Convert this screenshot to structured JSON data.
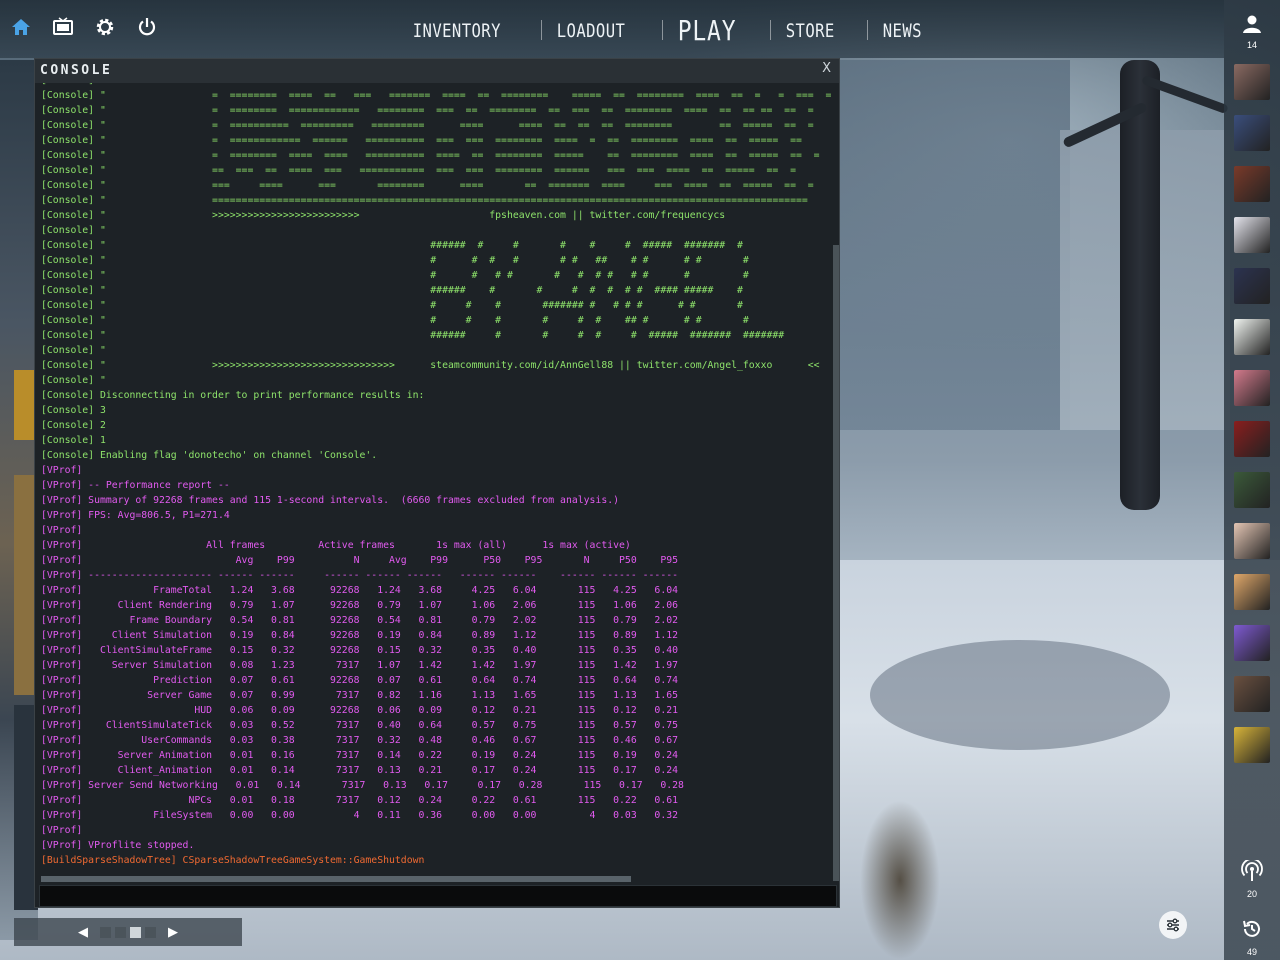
{
  "nav": {
    "items": [
      {
        "label": "INVENTORY",
        "name": "nav-inventory",
        "cls": ""
      },
      {
        "label": "LOADOUT",
        "name": "nav-loadout",
        "cls": ""
      },
      {
        "label": "PLAY",
        "name": "nav-play",
        "cls": "play"
      },
      {
        "label": "STORE",
        "name": "nav-store",
        "cls": ""
      },
      {
        "label": "NEWS",
        "name": "nav-news",
        "cls": ""
      }
    ],
    "icons": [
      "home-icon",
      "tv-icon",
      "gear-icon",
      "power-icon"
    ]
  },
  "sidebar": {
    "friends_count": "14",
    "avatars": [
      {
        "bg": "#8a6a62"
      },
      {
        "bg": "#3a4e7c"
      },
      {
        "bg": "#7a3a2a"
      },
      {
        "bg": "#e4e4ec"
      },
      {
        "bg": "#2c3350"
      },
      {
        "bg": "#f0f4f0"
      },
      {
        "bg": "#d37a8c"
      },
      {
        "bg": "#8a1e1e"
      },
      {
        "bg": "#3b5a3a"
      },
      {
        "bg": "#e4c6b4"
      },
      {
        "bg": "#e0a86a"
      },
      {
        "bg": "#7e5ad2"
      },
      {
        "bg": "#6a5040"
      },
      {
        "bg": "#d8b43a"
      }
    ],
    "broadcast_count": "20",
    "history_count": "49"
  },
  "console": {
    "title": "CONSOLE",
    "close_label": "X",
    "lines": [
      {
        "c": "con",
        "t": "[Console] \""
      },
      {
        "c": "con",
        "t": "[Console] \"                  =  ========  ====  ==   ===   =======  ====  ==  ========    =====  ==  ========  ====  ==  =   =  ===  ="
      },
      {
        "c": "con",
        "t": "[Console] \"                  =  ========  ============   ========  ===  ==  ========  ==  ===  ==  ========  ====  ==  == ==  ==  ="
      },
      {
        "c": "con",
        "t": "[Console] \"                  =  ==========  =========   =========      ====      ====  ==  ==  ==  ========        ==  =====  ==  ="
      },
      {
        "c": "con",
        "t": "[Console] \"                  =  ============  ======   ==========  ===  ===  ========  ====  =  ==  ========  ====  ==  =====  =="
      },
      {
        "c": "con",
        "t": "[Console] \"                  =  ========  ====  ====   ==========  ====  ==  ========  =====    ==  ========  ====  ==  =====  ==  ="
      },
      {
        "c": "con",
        "t": "[Console] \"                  ==  ===  ==  ====  ===   ===========  ===  ===  ========  ======   ===  ===  ====  ==  =====  ==  ="
      },
      {
        "c": "con",
        "t": "[Console] \"                  ===     ====      ===       ========      ====       ==  =======  ====     ===  ====  ==  =====  ==  ="
      },
      {
        "c": "con",
        "t": "[Console] \"                  ====================================================================================================="
      },
      {
        "c": "con",
        "t": "[Console] \"                  >>>>>>>>>>>>>>>>>>>>>>>>>                      fpsheaven.com || twitter.com/frequencycs"
      },
      {
        "c": "con",
        "t": "[Console] \""
      },
      {
        "c": "con",
        "t": "[Console] \"                                                       ######  #     #       #    #     #  #####  #######  #"
      },
      {
        "c": "con",
        "t": "[Console] \"                                                       #      #  #   #       # #   ##    # #      # #       #"
      },
      {
        "c": "con",
        "t": "[Console] \"                                                       #      #   # #       #   #  # #   # #      #         #"
      },
      {
        "c": "con",
        "t": "[Console] \"                                                       ######    #       #     #  #  #  # #  #### #####    #"
      },
      {
        "c": "con",
        "t": "[Console] \"                                                       #     #    #       ####### #   # # #      # #       #"
      },
      {
        "c": "con",
        "t": "[Console] \"                                                       #     #    #       #     #  #    ## #      # #       #"
      },
      {
        "c": "con",
        "t": "[Console] \"                                                       ######     #       #     #  #     #  #####  #######  #######"
      },
      {
        "c": "con",
        "t": "[Console] \""
      },
      {
        "c": "con",
        "t": "[Console] \"                  >>>>>>>>>>>>>>>>>>>>>>>>>>>>>>>      steamcommunity.com/id/AnnGell88 || twitter.com/Angel_foxxo      <<"
      },
      {
        "c": "con",
        "t": "[Console] \""
      },
      {
        "c": "con",
        "t": "[Console] Disconnecting in order to print performance results in:"
      },
      {
        "c": "con",
        "t": "[Console] 3"
      },
      {
        "c": "con",
        "t": "[Console] 2"
      },
      {
        "c": "con",
        "t": "[Console] 1"
      },
      {
        "c": "con",
        "t": "[Console] Enabling flag 'donotecho' on channel 'Console'."
      },
      {
        "c": "vp",
        "t": "[VProf]"
      },
      {
        "c": "vp",
        "t": "[VProf] -- Performance report --"
      },
      {
        "c": "vp",
        "t": "[VProf] Summary of 92268 frames and 115 1-second intervals.  (6660 frames excluded from analysis.)"
      },
      {
        "c": "vp",
        "t": "[VProf] FPS: Avg=806.5, P1=271.4"
      },
      {
        "c": "vp",
        "t": "[VProf]"
      },
      {
        "c": "vp",
        "t": "[VProf]                     All frames         Active frames       1s max (all)      1s max (active)"
      },
      {
        "c": "vp",
        "t": "[VProf]                          Avg    P99          N     Avg    P99      P50    P95       N     P50    P95"
      },
      {
        "c": "vp",
        "t": "[VProf] --------------------- ------ ------     ------ ------ ------   ------ ------    ------ ------ ------"
      },
      {
        "c": "vp",
        "t": "[VProf]            FrameTotal   1.24   3.68      92268   1.24   3.68     4.25   6.04       115   4.25   6.04"
      },
      {
        "c": "vp",
        "t": "[VProf]      Client Rendering   0.79   1.07      92268   0.79   1.07     1.06   2.06       115   1.06   2.06"
      },
      {
        "c": "vp",
        "t": "[VProf]        Frame Boundary   0.54   0.81      92268   0.54   0.81     0.79   2.02       115   0.79   2.02"
      },
      {
        "c": "vp",
        "t": "[VProf]     Client Simulation   0.19   0.84      92268   0.19   0.84     0.89   1.12       115   0.89   1.12"
      },
      {
        "c": "vp",
        "t": "[VProf]   ClientSimulateFrame   0.15   0.32      92268   0.15   0.32     0.35   0.40       115   0.35   0.40"
      },
      {
        "c": "vp",
        "t": "[VProf]     Server Simulation   0.08   1.23       7317   1.07   1.42     1.42   1.97       115   1.42   1.97"
      },
      {
        "c": "vp",
        "t": "[VProf]            Prediction   0.07   0.61      92268   0.07   0.61     0.64   0.74       115   0.64   0.74"
      },
      {
        "c": "vp",
        "t": "[VProf]           Server Game   0.07   0.99       7317   0.82   1.16     1.13   1.65       115   1.13   1.65"
      },
      {
        "c": "vp",
        "t": "[VProf]                   HUD   0.06   0.09      92268   0.06   0.09     0.12   0.21       115   0.12   0.21"
      },
      {
        "c": "vp",
        "t": "[VProf]    ClientSimulateTick   0.03   0.52       7317   0.40   0.64     0.57   0.75       115   0.57   0.75"
      },
      {
        "c": "vp",
        "t": "[VProf]          UserCommands   0.03   0.38       7317   0.32   0.48     0.46   0.67       115   0.46   0.67"
      },
      {
        "c": "vp",
        "t": "[VProf]      Server Animation   0.01   0.16       7317   0.14   0.22     0.19   0.24       115   0.19   0.24"
      },
      {
        "c": "vp",
        "t": "[VProf]      Client_Animation   0.01   0.14       7317   0.13   0.21     0.17   0.24       115   0.17   0.24"
      },
      {
        "c": "vp",
        "t": "[VProf] Server Send Networking   0.01   0.14       7317   0.13   0.17     0.17   0.28       115   0.17   0.28"
      },
      {
        "c": "vp",
        "t": "[VProf]                  NPCs   0.01   0.18       7317   0.12   0.24     0.22   0.61       115   0.22   0.61"
      },
      {
        "c": "vp",
        "t": "[VProf]            FileSystem   0.00   0.00          4   0.11   0.36     0.00   0.00         4   0.03   0.32"
      },
      {
        "c": "vp",
        "t": "[VProf]"
      },
      {
        "c": "vp",
        "t": "[VProf] VProflite stopped."
      },
      {
        "c": "bs",
        "t": "[BuildSparseShadowTree] CSparseShadowTreeGameSystem::GameShutdown"
      }
    ],
    "input_value": ""
  },
  "pager": {
    "prev": "◀",
    "next": "▶",
    "pages": 4,
    "active": 3
  },
  "colors": {
    "console_green": "#8ee36b",
    "vprof_magenta": "#e25bf0",
    "shadowtree_orange": "#f06a32",
    "home_blue": "#4aa3e6"
  }
}
